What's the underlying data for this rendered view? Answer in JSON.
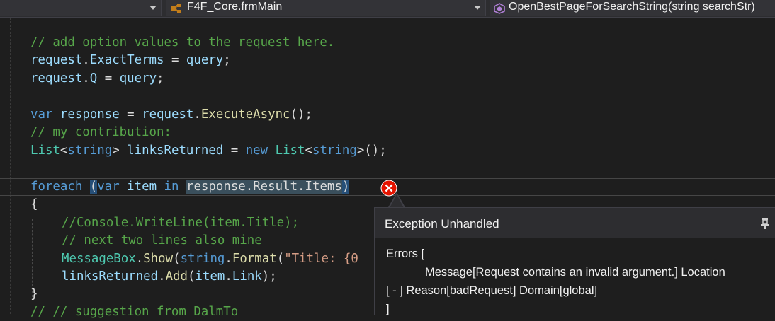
{
  "navbar": {
    "class_selector": "F4F_Core.frmMain",
    "member_selector": "OpenBestPageForSearchString(string searchStr)"
  },
  "code": {
    "l1": "// add option values to the request here.",
    "l2": [
      "request",
      ".",
      "ExactTerms",
      " = ",
      "query",
      ";"
    ],
    "l3": [
      "request",
      ".",
      "Q",
      " = ",
      "query",
      ";"
    ],
    "l5": [
      "var",
      " ",
      "response",
      " = ",
      "request",
      ".",
      "ExecuteAsync",
      "();"
    ],
    "l6": "// my contribution:",
    "l7": [
      "List",
      "<",
      "string",
      "> ",
      "linksReturned",
      " = ",
      "new",
      " ",
      "List",
      "<",
      "string",
      ">();"
    ],
    "l9": [
      "foreach",
      " ",
      "(",
      "var",
      " ",
      "item",
      " ",
      "in",
      " ",
      "response.Result.Items",
      ")"
    ],
    "l10": "{",
    "l11": "//Console.WriteLine(item.Title);",
    "l12": "// next two lines also mine",
    "l13": [
      "MessageBox",
      ".",
      "Show",
      "(",
      "string",
      ".",
      "Format",
      "(",
      "\"Title: {0"
    ],
    "l14": [
      "linksReturned",
      ".",
      "Add",
      "(",
      "item",
      ".",
      "Link",
      ");"
    ],
    "l15": "}",
    "l16": "// // suggestion from DalmTo"
  },
  "exception": {
    "title": "Exception Unhandled",
    "line1": "Errors [",
    "line2": "            Message[Request contains an invalid argument.] Location",
    "line3": "[ - ] Reason[badRequest] Domain[global]",
    "line4": "]"
  },
  "colors": {
    "background": "#1e1e1e",
    "comment": "#57a64a",
    "keyword": "#569cd6",
    "type": "#4ec9b0",
    "error": "#e51400"
  },
  "icons": [
    "dropdown-icon",
    "class-icon",
    "method-icon",
    "error-icon",
    "pin-icon"
  ]
}
